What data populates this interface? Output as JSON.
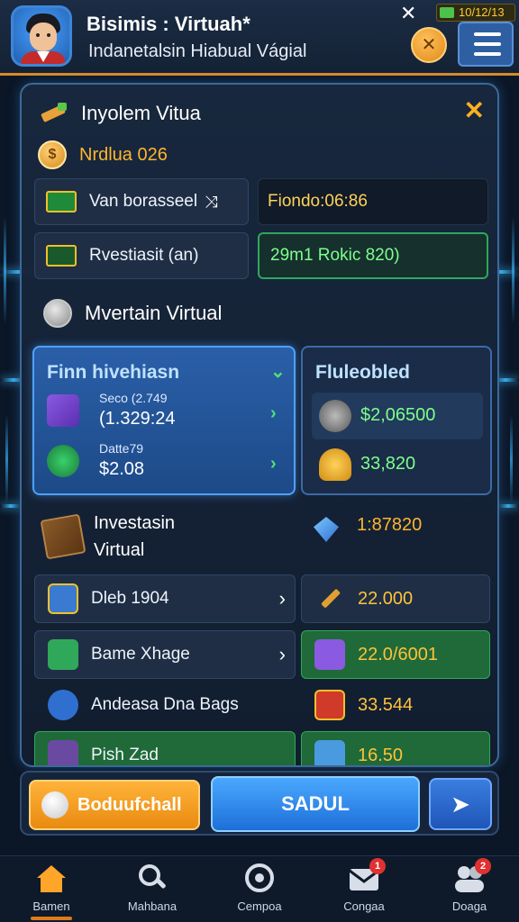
{
  "header": {
    "app_title": "Bisimis : Virtuah*",
    "app_subtitle": "Indanetalsin Hiabual Vágial",
    "battery_text": "10/12/13",
    "close_glyph": "✕"
  },
  "panel": {
    "title": "Inyolem Vitua",
    "close_glyph": "✕",
    "coin_label": "Nrdlua 026",
    "row1_left": "Van borasseel",
    "row1_right": "Fiondo:06:86",
    "row2_left": "Rvestiasit (an)",
    "row2_right": "29m1 Rokic 820)",
    "section_title": "Mvertain Virtual",
    "card_left": {
      "title": "Finn hivehiasn",
      "item1_small": "Seco (2.749",
      "item1_value": "(1.329:24",
      "item2_small": "Datte79",
      "item2_value": "$2.08"
    },
    "card_right": {
      "title": "Fluleobled",
      "item1_value": "$2,06500",
      "item2_value": "33,820"
    },
    "invest_title_line1": "Investasin",
    "invest_title_line2": "Virtual",
    "invest_value": "1:87820",
    "list": [
      {
        "label": "Dleb 1904",
        "value": "22.000"
      },
      {
        "label": "Bame Xhage",
        "value": "22.0/6001"
      },
      {
        "label": "Andeasa Dna Bags",
        "value": "33.544"
      },
      {
        "label": "Pish Zad",
        "value": "16.50"
      }
    ]
  },
  "bottom": {
    "left_button": "Boduufchall",
    "center_button": "SADUL",
    "send_glyph": "➤"
  },
  "tabs": [
    {
      "label": "Bamen",
      "icon": "home-icon"
    },
    {
      "label": "Mahbana",
      "icon": "search-icon"
    },
    {
      "label": "Cempoa",
      "icon": "compass-icon",
      "badge": ""
    },
    {
      "label": "Congaa",
      "icon": "mail-icon",
      "badge": "1"
    },
    {
      "label": "Doaga",
      "icon": "people-icon",
      "badge": "2"
    }
  ],
  "colors": {
    "accent_orange": "#e98a10",
    "accent_blue": "#1d6fd8",
    "value_green": "#7dff8a",
    "value_amber": "#ffc23a"
  }
}
